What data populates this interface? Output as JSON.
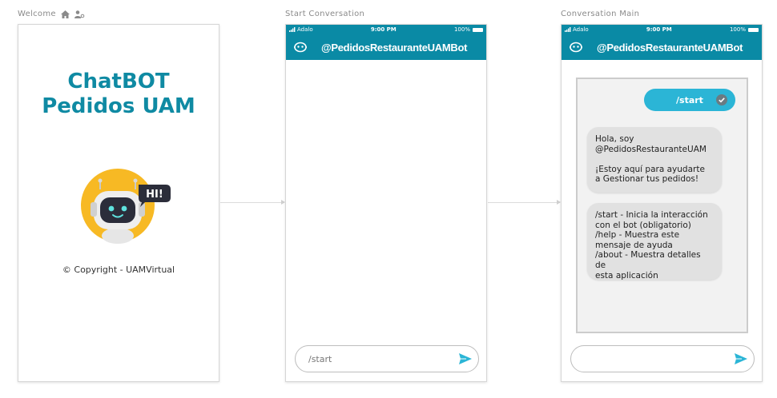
{
  "screens": [
    {
      "label": "Welcome"
    },
    {
      "label": "Start Conversation"
    },
    {
      "label": "Conversation Main"
    }
  ],
  "welcome": {
    "title_line1": "ChatBOT",
    "title_line2": "Pedidos UAM",
    "robot_badge": "HI!",
    "copyright": "© Copyright - UAMVirtual"
  },
  "status_bar": {
    "carrier": "Adalo",
    "time": "9:00 PM",
    "battery": "100%"
  },
  "app_bar": {
    "title": "@PedidosRestauranteUAMBot"
  },
  "start_conversation": {
    "input_placeholder": "/start"
  },
  "conversation_main": {
    "user_message": "/start",
    "bot_message_1": "Hola, soy\n@PedidosRestauranteUAM\n\n¡Estoy aquí para ayudarte\na Gestionar tus pedidos!",
    "bot_message_2": "/start - Inicia la interacción\ncon el bot (obligatorio)\n/help - Muestra este\nmensaje de ayuda\n/about - Muestra detalles de\nesta aplicación",
    "input_value": ""
  },
  "colors": {
    "accent": "#0a8aa5",
    "title": "#0f8aa3",
    "user_bubble": "#2bb5d6",
    "send_icon": "#2bb5d6"
  },
  "icons": [
    "home-icon",
    "user-key-icon",
    "bot-icon",
    "send-icon",
    "check-circle-icon",
    "signal-icon",
    "battery-icon"
  ]
}
